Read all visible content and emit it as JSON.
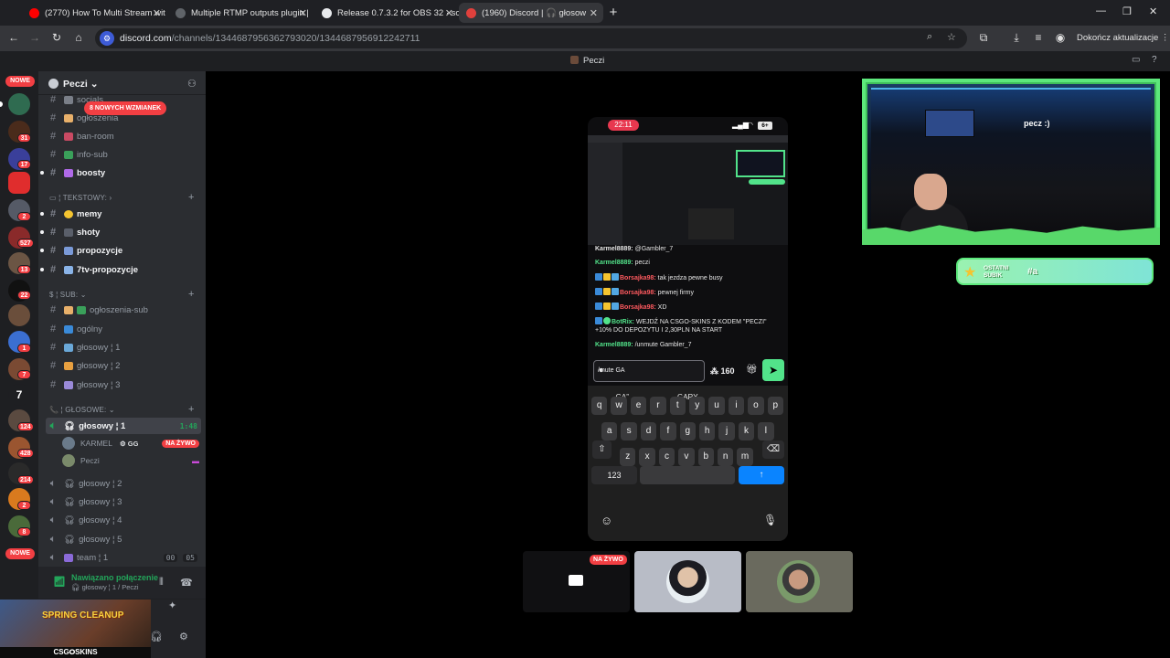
{
  "browser": {
    "tabs": [
      {
        "title": "(2770) How To Multi Stream wit"
      },
      {
        "title": "Multiple RTMP outputs plugin |"
      },
      {
        "title": "Release 0.7.3.2 for OBS 32 · sora"
      },
      {
        "title": "(1960) Discord | 🎧 głosow"
      }
    ],
    "url_host": "discord.com",
    "url_path": "/channels/1344687956362793020/1344687956912242711",
    "update_label": "Dokończ aktualizacje"
  },
  "discord": {
    "title": "Peczi",
    "guild_name": "Peczi",
    "rail": {
      "nowe_top": "NOWE",
      "nowe_bottom": "NOWE",
      "badges": [
        "31",
        "17",
        "2",
        "527",
        "13",
        "22",
        "1",
        "7",
        "124",
        "428",
        "214",
        "2",
        "8"
      ]
    },
    "mentions_label": "8 NOWYCH WZMIANEK",
    "channels_top": [
      {
        "name": "socials"
      },
      {
        "name": "ogłoszenia"
      },
      {
        "name": "ban-room"
      },
      {
        "name": "info-sub"
      },
      {
        "name": "boosty"
      }
    ],
    "cat_text": "TEKSTOWY:",
    "channels_text": [
      {
        "name": "memy"
      },
      {
        "name": "shoty"
      },
      {
        "name": "propozycje"
      },
      {
        "name": "7tv-propozycje"
      }
    ],
    "cat_sub": "SUB:",
    "channels_sub": [
      {
        "name": "ogłoszenia-sub"
      },
      {
        "name": "ogólny"
      },
      {
        "name": "głosowy ¦ 1"
      },
      {
        "name": "głosowy ¦ 2"
      },
      {
        "name": "głosowy ¦ 3"
      }
    ],
    "cat_voice": "GŁOSOWE:",
    "voice_active": {
      "name": "głosowy ¦ 1",
      "timer": "1:48"
    },
    "voice_users": [
      {
        "name": "KARMEL",
        "tag": "GG",
        "live": "NA ŻYWO"
      },
      {
        "name": "Peczi"
      }
    ],
    "channels_voice": [
      {
        "name": "głosowy ¦ 2"
      },
      {
        "name": "głosowy ¦ 3"
      },
      {
        "name": "głosowy ¦ 4"
      },
      {
        "name": "głosowy ¦ 5"
      },
      {
        "name": "team ¦ 1",
        "count_a": "00",
        "count_b": "05"
      }
    ],
    "connection": {
      "status": "Nawiązano połączenie",
      "detail": "głosowy ¦ 1 / Peczi"
    },
    "promo": {
      "title": "SPRING CLEANUP",
      "brand": "CSG🞇SKINS"
    }
  },
  "phone": {
    "time": "22:11",
    "battery": "6+",
    "chat": [
      {
        "user": "Karmel8889:",
        "text": "@Gambler_7",
        "user_color": "#efeff1"
      },
      {
        "user": "Karmel8889:",
        "text": "peczi",
        "user_color": "#52e38a"
      },
      {
        "user": "Borsajka98:",
        "text": "tak jezdza pewne busy",
        "user_color": "#ff5a5f"
      },
      {
        "user": "Borsajka98:",
        "text": "pewnej firmy",
        "user_color": "#ff5a5f"
      },
      {
        "user": "Borsajka98:",
        "text": "XD",
        "user_color": "#ff5a5f"
      },
      {
        "user": "BotRix:",
        "text": "WEJDŹ NA CSGO-SKINS Z KODEM \"PECZI\" +10% DO DEPOZYTU I 2,30PLN NA START",
        "user_color": "#52e38a"
      },
      {
        "user": "Karmel8889:",
        "text": "/unmute Gambler_7",
        "user_color": "#52e38a"
      }
    ],
    "input_value": "/mute GA",
    "points": "160",
    "suggestions": [
      "„GA”",
      "GARY"
    ],
    "keys_row1": [
      "q",
      "w",
      "e",
      "r",
      "t",
      "y",
      "u",
      "i",
      "o",
      "p"
    ],
    "keys_row2": [
      "a",
      "s",
      "d",
      "f",
      "g",
      "h",
      "j",
      "k",
      "l"
    ],
    "keys_row3": [
      "z",
      "x",
      "c",
      "v",
      "b",
      "n",
      "m"
    ],
    "key_123": "123"
  },
  "overlay": {
    "cam_text": "pecz :)",
    "lastsub_label_1": "OSTATNI",
    "lastsub_label_2": "SUBIK",
    "lastsub_value": "#a"
  },
  "participants": {
    "live_label": "NA ŻYWO"
  },
  "colors": {
    "discord_red": "#f23f43",
    "discord_green": "#23a55a",
    "kick_green": "#52e38a"
  }
}
